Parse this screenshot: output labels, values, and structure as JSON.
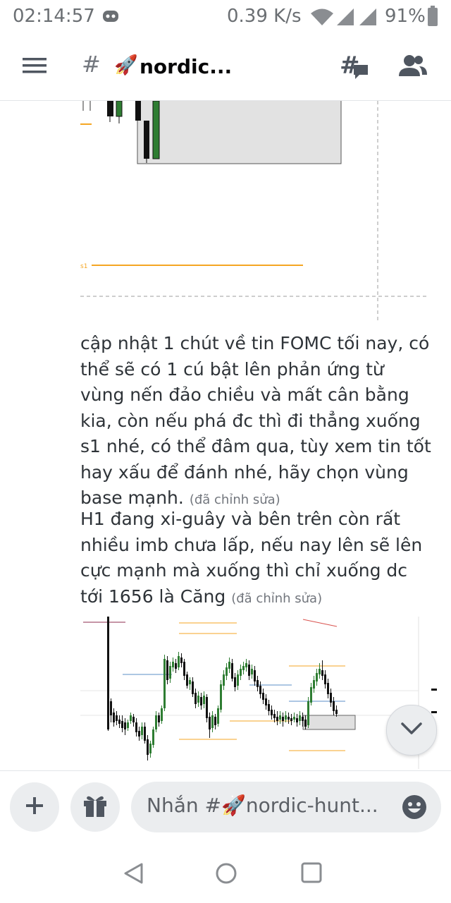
{
  "status_bar": {
    "time": "02:14:57",
    "network_speed": "0.39 K/s",
    "battery": "91%"
  },
  "header": {
    "channel_hash": "#",
    "channel_emoji": "🚀",
    "channel_name": "nordic..."
  },
  "messages": [
    {
      "text": "cập nhật 1 chút về tin FOMC tối nay, có thể sẽ có 1 cú bật lên phản ứng từ vùng nến đảo chiều và mất cân bằng kia, còn nếu phá đc thì đi thẳng xuống s1 nhé, có thể đâm qua, tùy xem tin tốt hay xấu để đánh nhé, hãy chọn vùng base mạnh.",
      "edited": "(đã chỉnh sửa)"
    },
    {
      "text": "H1 đang xi-guây và bên trên còn rất nhiều imb chưa lấp, nếu nay lên sẽ lên cực mạnh mà xuống thì chỉ xuống dc tới 1656 là Căng",
      "edited": "(đã chỉnh sửa)"
    }
  ],
  "chart_top": {
    "label": "s1"
  },
  "composer": {
    "placeholder": "Nhắn #🚀nordic-hunt..."
  },
  "icons": {
    "menu": "hamburger-menu-icon",
    "threads": "threads-icon",
    "members": "members-icon",
    "add": "plus-icon",
    "gift": "gift-icon",
    "emoji": "emoji-icon",
    "scroll": "chevron-down-icon",
    "back": "nav-back-icon",
    "home": "nav-home-icon",
    "recents": "nav-recents-icon"
  },
  "colors": {
    "accent_orange": "#f5a623",
    "candle_green": "#2e7d32",
    "candle_black": "#111111",
    "zone_gray": "#e0e0e0"
  }
}
